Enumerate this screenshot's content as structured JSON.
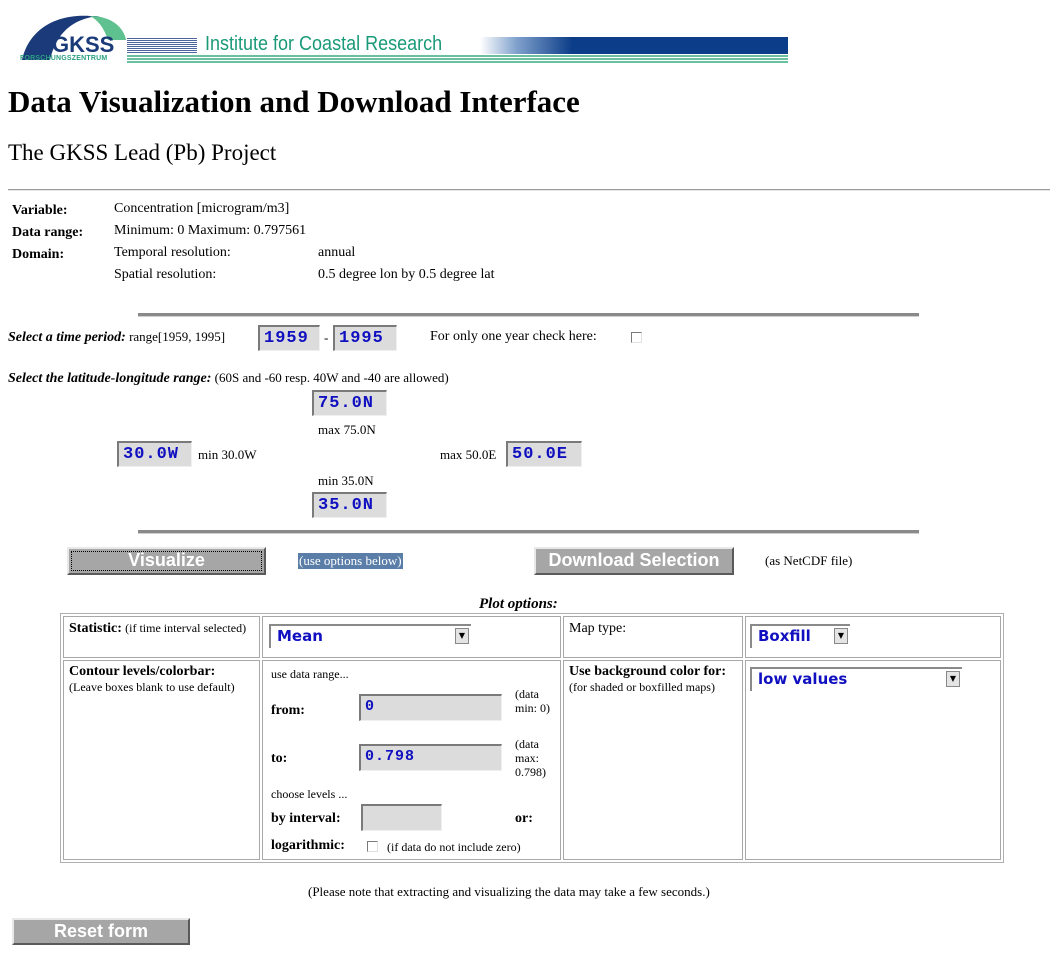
{
  "header": {
    "logo_text": "GKSS",
    "logo_subtext": "FORSCHUNGSZENTRUM",
    "institute": "Institute for Coastal Research",
    "brand_colors": {
      "blue": "#0c3d88",
      "green": "#1a9a78"
    }
  },
  "page_title": "Data Visualization and Download Interface",
  "project_title": "The GKSS Lead (Pb) Project",
  "info": {
    "variable_label": "Variable:",
    "variable_value": "Concentration [microgram/m3]",
    "range_label": "Data range:",
    "range_value": "Minimum: 0 Maximum: 0.797561",
    "domain_label": "Domain:",
    "temporal_label": "Temporal resolution:",
    "temporal_value": "annual",
    "spatial_label": "Spatial resolution:",
    "spatial_value": "0.5 degree lon by 0.5 degree lat"
  },
  "time": {
    "label": "Select a time period:",
    "range_hint": "range[1959, 1995]",
    "start": "1959",
    "separator": "-",
    "end": "1995",
    "one_year_label": "For only one year check here:",
    "one_year_checked": false
  },
  "latlon": {
    "label": "Select the latitude-longitude range:",
    "hint": "(60S and -60 resp. 40W and -40 are allowed)",
    "north": "75.0N",
    "north_note": "max 75.0N",
    "west": "30.0W",
    "west_note": "min 30.0W",
    "east_note": "max 50.0E",
    "east": "50.0E",
    "south_note": "min 35.0N",
    "south": "35.0N"
  },
  "actions": {
    "visualize": "Visualize",
    "visualize_note": "(use options below)",
    "download": "Download Selection",
    "download_note": "(as NetCDF file)"
  },
  "plot_options": {
    "title": "Plot options:",
    "statistic_label": "Statistic:",
    "statistic_note": "(if time interval selected)",
    "statistic_value": "Mean",
    "maptype_label": "Map type:",
    "maptype_value": "Boxfill",
    "contour_label": "Contour levels/colorbar:",
    "contour_note": "(Leave boxes blank to use default)",
    "use_range": "use data range...",
    "from_label": "from:",
    "from_value": "0",
    "from_note": "(data min: 0)",
    "to_label": "to:",
    "to_value": "0.798",
    "to_note": "(data max: 0.798)",
    "choose_levels": "choose levels ...",
    "interval_label": "by interval:",
    "interval_value": "",
    "or_label": "or:",
    "log_label": "logarithmic:",
    "log_checked": false,
    "log_note": "(if data do not include zero)",
    "bg_label": "Use background color for:",
    "bg_note": "(for shaded or boxfilled maps)",
    "bg_value": "low values"
  },
  "footer": {
    "note": "(Please note that extracting and visualizing the data may take a few seconds.)",
    "reset": "Reset form"
  }
}
